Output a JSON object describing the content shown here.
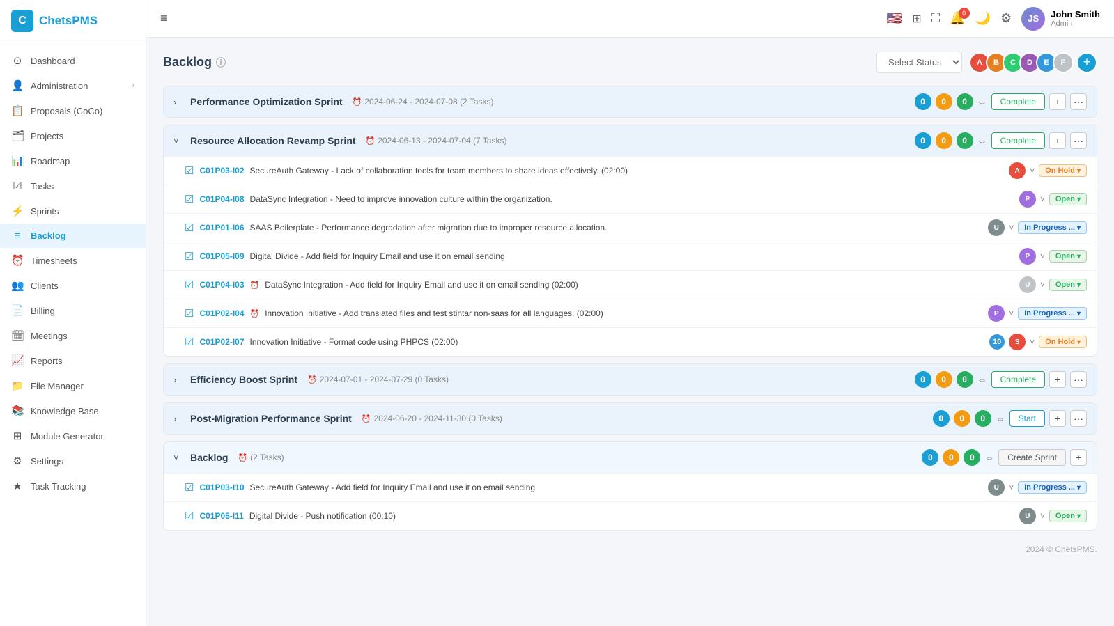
{
  "app": {
    "name": "ChetsPMS",
    "logo_char": "C"
  },
  "sidebar": {
    "items": [
      {
        "id": "dashboard",
        "label": "Dashboard",
        "icon": "⊙"
      },
      {
        "id": "administration",
        "label": "Administration",
        "icon": "👤",
        "has_arrow": true
      },
      {
        "id": "proposals",
        "label": "Proposals (CoCo)",
        "icon": "📋"
      },
      {
        "id": "projects",
        "label": "Projects",
        "icon": "🗂"
      },
      {
        "id": "roadmap",
        "label": "Roadmap",
        "icon": "📊"
      },
      {
        "id": "tasks",
        "label": "Tasks",
        "icon": "☑"
      },
      {
        "id": "sprints",
        "label": "Sprints",
        "icon": "⚡"
      },
      {
        "id": "backlog",
        "label": "Backlog",
        "icon": "≡",
        "active": true
      },
      {
        "id": "timesheets",
        "label": "Timesheets",
        "icon": "⏰"
      },
      {
        "id": "clients",
        "label": "Clients",
        "icon": "👥"
      },
      {
        "id": "billing",
        "label": "Billing",
        "icon": "📄"
      },
      {
        "id": "meetings",
        "label": "Meetings",
        "icon": "🗓"
      },
      {
        "id": "reports",
        "label": "Reports",
        "icon": "📈"
      },
      {
        "id": "file-manager",
        "label": "File Manager",
        "icon": "📁"
      },
      {
        "id": "knowledge-base",
        "label": "Knowledge Base",
        "icon": "📚"
      },
      {
        "id": "module-generator",
        "label": "Module Generator",
        "icon": "⊞"
      },
      {
        "id": "settings",
        "label": "Settings",
        "icon": "⚙"
      },
      {
        "id": "task-tracking",
        "label": "Task Tracking",
        "icon": "★"
      }
    ]
  },
  "topbar": {
    "hamburger": "≡",
    "notif_count": "0",
    "user": {
      "name": "John Smith",
      "role": "Admin"
    }
  },
  "page": {
    "title": "Backlog",
    "info_icon": "ⓘ",
    "status_placeholder": "Select Status",
    "add_label": "+",
    "footer": "2024 © ChetsPMS."
  },
  "avatars": [
    {
      "color": "#e74c3c",
      "char": "A"
    },
    {
      "color": "#e67e22",
      "char": "B"
    },
    {
      "color": "#2ecc71",
      "char": "C"
    },
    {
      "color": "#9b59b6",
      "char": "D"
    },
    {
      "color": "#3498db",
      "char": "E"
    },
    {
      "color": "#bdc3c7",
      "char": "F"
    }
  ],
  "sprints": [
    {
      "id": "s1",
      "name": "Performance Optimization Sprint",
      "dates": "2024-06-24 - 2024-07-08",
      "task_count": "2 Tasks",
      "collapsed": true,
      "counts": [
        0,
        0,
        0
      ],
      "action": "Complete",
      "action_type": "complete",
      "tasks": []
    },
    {
      "id": "s2",
      "name": "Resource Allocation Revamp Sprint",
      "dates": "2024-06-13 - 2024-07-04",
      "task_count": "7 Tasks",
      "collapsed": false,
      "counts": [
        0,
        0,
        0
      ],
      "action": "Complete",
      "action_type": "complete",
      "tasks": [
        {
          "id": "C01P03-I02",
          "desc": "SecureAuth Gateway - Lack of collaboration tools for team members to share ideas effectively. (02:00)",
          "status": "On Hold",
          "status_type": "on-hold",
          "avatar_color": "#e74c3c",
          "avatar_char": "A",
          "has_clock": false
        },
        {
          "id": "C01P04-I08",
          "desc": "DataSync Integration - Need to improve innovation culture within the organization.",
          "status": "Open",
          "status_type": "open",
          "avatar_color": "#a06ee0",
          "avatar_char": "P",
          "has_clock": false
        },
        {
          "id": "C01P01-I06",
          "desc": "SAAS Boilerplate - Performance degradation after migration due to improper resource allocation.",
          "status": "In Progress ...",
          "status_type": "in-progress",
          "avatar_color": "#7f8c8d",
          "avatar_char": "U",
          "has_clock": false
        },
        {
          "id": "C01P05-I09",
          "desc": "Digital Divide - Add field for Inquiry Email and use it on email sending",
          "status": "Open",
          "status_type": "open",
          "avatar_color": "#a06ee0",
          "avatar_char": "P",
          "has_clock": false
        },
        {
          "id": "C01P04-I03",
          "desc": "DataSync Integration - Add field for Inquiry Email and use it on email sending (02:00)",
          "status": "Open",
          "status_type": "open",
          "avatar_color": "#bdc3c7",
          "avatar_char": "U",
          "has_clock": true
        },
        {
          "id": "C01P02-I04",
          "desc": "Innovation Initiative - Add translated files and test stintar non-saas for all languages. (02:00)",
          "status": "In Progress ...",
          "status_type": "in-progress",
          "avatar_color": "#a06ee0",
          "avatar_char": "P",
          "has_clock": true
        },
        {
          "id": "C01P02-I07",
          "desc": "Innovation Initiative - Format code using PHPCS (02:00)",
          "status": "On Hold",
          "status_type": "on-hold",
          "avatar_color": "#e74c3c",
          "avatar_char": "S",
          "num_badge": "10",
          "has_clock": false
        }
      ]
    },
    {
      "id": "s3",
      "name": "Efficiency Boost Sprint",
      "dates": "2024-07-01 - 2024-07-29",
      "task_count": "0 Tasks",
      "collapsed": true,
      "counts": [
        0,
        0,
        0
      ],
      "action": "Complete",
      "action_type": "complete",
      "tasks": []
    },
    {
      "id": "s4",
      "name": "Post-Migration Performance Sprint",
      "dates": "2024-06-20 - 2024-11-30",
      "task_count": "0 Tasks",
      "collapsed": true,
      "counts": [
        0,
        0,
        0
      ],
      "action": "Start",
      "action_type": "start",
      "tasks": []
    },
    {
      "id": "backlog",
      "name": "Backlog",
      "dates": "",
      "task_count": "2 Tasks",
      "collapsed": false,
      "is_backlog": true,
      "counts": [
        0,
        0,
        0
      ],
      "action": "Create Sprint",
      "action_type": "create",
      "tasks": [
        {
          "id": "C01P03-I10",
          "desc": "SecureAuth Gateway - Add field for Inquiry Email and use it on email sending",
          "status": "In Progress ...",
          "status_type": "in-progress",
          "avatar_color": "#7f8c8d",
          "avatar_char": "U",
          "has_clock": false
        },
        {
          "id": "C01P05-I11",
          "desc": "Digital Divide - Push notification (00:10)",
          "status": "Open",
          "status_type": "open",
          "avatar_color": "#7f8c8d",
          "avatar_char": "U",
          "has_clock": false
        }
      ]
    }
  ]
}
